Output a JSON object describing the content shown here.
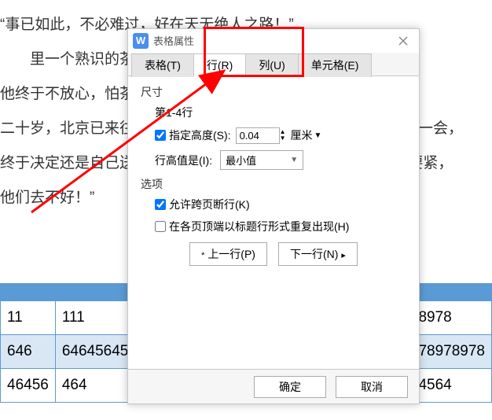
{
  "doc_lines": [
    "“事已如此，不必难过，好在天无绝人之路！”",
    "　　里一个熟识的茶房……他再三嘱屛茶房，甚是仔细。但",
    "他终于不放心，怕茶房不妥帖；颇踌躇了一会。其实我那年已",
    "二十岁，北京已来往过两三次，是没有甚么要紧的了。他踌躇了一会，",
    "终于决定还是自己送我去。我两三回劝他不必去；他只说，“不要紧，",
    "他们去不好！”"
  ],
  "table": {
    "rows": [
      [
        "11",
        "111",
        "",
        "8978"
      ],
      [
        "646",
        "64645645",
        "",
        "78978978"
      ],
      [
        "46456",
        "464",
        "",
        "4564"
      ]
    ]
  },
  "dialog": {
    "title": "表格属性",
    "tabs": {
      "t0": "表格(T)",
      "t1": "行(R)",
      "t2": "列(U)",
      "t3": "单元格(E)"
    },
    "size_label": "尺寸",
    "row_range": "第1-4行",
    "spec_height_label": "指定高度(S):",
    "spec_height_val": "0.04",
    "spec_height_unit": "厘米",
    "row_height_label": "行高值是(I):",
    "row_height_val": "最小值",
    "options_label": "选项",
    "allow_break": "允许跨页断行(K)",
    "repeat_header": "在各页顶端以标题行形式重复出现(H)",
    "prev_row": "上一行(P)",
    "next_row": "下一行(N)",
    "ok": "确定",
    "cancel": "取消"
  }
}
